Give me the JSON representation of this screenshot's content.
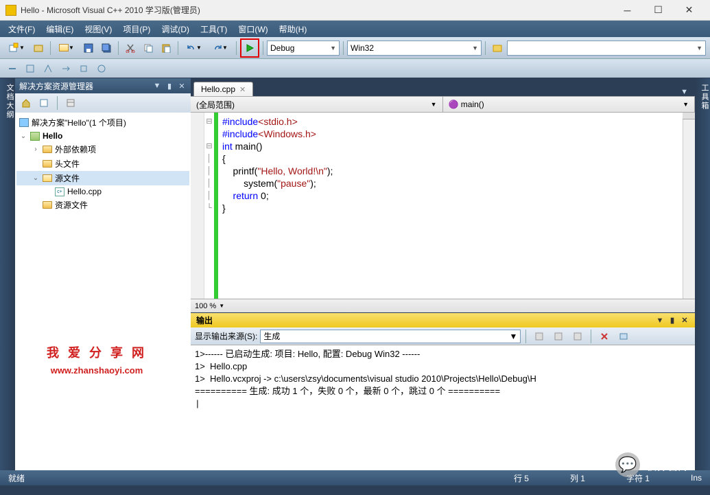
{
  "title": "Hello - Microsoft Visual C++ 2010 学习版(管理员)",
  "menu": [
    "文件(F)",
    "编辑(E)",
    "视图(V)",
    "项目(P)",
    "调试(D)",
    "工具(T)",
    "窗口(W)",
    "帮助(H)"
  ],
  "toolbar": {
    "config": "Debug",
    "platform": "Win32"
  },
  "left_tab": "文档大纲",
  "right_tab": "工具箱",
  "solution": {
    "title": "解决方案资源管理器",
    "root": "解决方案\"Hello\"(1 个项目)",
    "project": "Hello",
    "folders": {
      "external": "外部依赖项",
      "headers": "头文件",
      "sources": "源文件",
      "resources": "资源文件"
    },
    "file": "Hello.cpp"
  },
  "editor": {
    "tab": "Hello.cpp",
    "scope_left": "(全局范围)",
    "scope_right": "main()",
    "zoom": "100 %",
    "code": {
      "l1a": "#include",
      "l1b": "<stdio.h>",
      "l2a": "#include",
      "l2b": "<Windows.h>",
      "l3a": "int",
      "l3b": " main()",
      "l4": "{",
      "l5a": "    printf(",
      "l5b": "\"Hello, World!\\n\"",
      "l5c": ");",
      "l6a": "        system(",
      "l6b": "\"pause\"",
      "l6c": ");",
      "l7a": "    return",
      "l7b": " 0;",
      "l8": "}"
    }
  },
  "output": {
    "title": "输出",
    "source_label": "显示输出来源(S):",
    "source": "生成",
    "lines": [
      "1>------ 已启动生成: 项目: Hello, 配置: Debug Win32 ------",
      "1>  Hello.cpp",
      "1>  Hello.vcxproj -> c:\\users\\zsy\\documents\\visual studio 2010\\Projects\\Hello\\Debug\\H",
      "========== 生成: 成功 1 个，失败 0 个，最新 0 个，跳过 0 个 ==========",
      ""
    ]
  },
  "status": {
    "ready": "就绪",
    "line": "行 5",
    "col": "列 1",
    "char": "字符 1",
    "ins": "Ins"
  },
  "watermark": {
    "text": "我 爱 分 享 网",
    "url": "www.zhanshaoyi.com"
  },
  "bottom_wm": "软件智库"
}
